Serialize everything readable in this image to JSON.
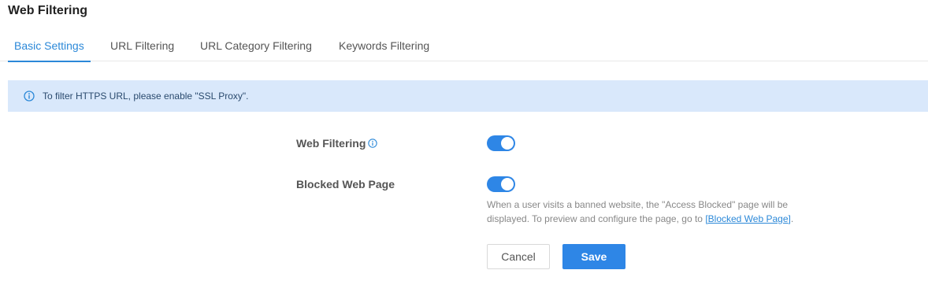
{
  "page": {
    "title": "Web Filtering"
  },
  "tabs": [
    {
      "label": "Basic Settings",
      "active": true
    },
    {
      "label": "URL Filtering",
      "active": false
    },
    {
      "label": "URL Category Filtering",
      "active": false
    },
    {
      "label": "Keywords Filtering",
      "active": false
    }
  ],
  "alert": {
    "text": "To filter HTTPS URL, please enable \"SSL Proxy\".",
    "icon": "info-circle-icon"
  },
  "form": {
    "web_filtering": {
      "label": "Web Filtering",
      "enabled": true,
      "help_icon": "info-circle-icon"
    },
    "blocked_web_page": {
      "label": "Blocked Web Page",
      "enabled": true,
      "help_prefix": "When a user visits a banned website, the \"Access Blocked\" page will be displayed. To preview and configure the page, go to ",
      "help_link": "[Blocked Web Page]",
      "help_suffix": "."
    }
  },
  "buttons": {
    "cancel": "Cancel",
    "save": "Save"
  },
  "colors": {
    "accent": "#2e86e6",
    "alert_bg": "#d9e8fb",
    "active_tab": "#2b88d8"
  }
}
